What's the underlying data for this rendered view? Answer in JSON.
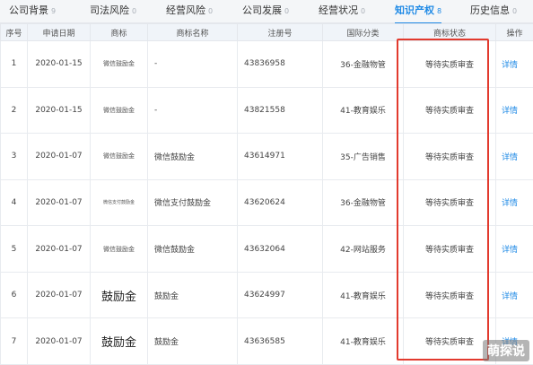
{
  "tabs": [
    {
      "label": "公司背景",
      "count": "9",
      "active": false
    },
    {
      "label": "司法风险",
      "count": "0",
      "active": false
    },
    {
      "label": "经营风险",
      "count": "0",
      "active": false
    },
    {
      "label": "公司发展",
      "count": "0",
      "active": false
    },
    {
      "label": "经营状况",
      "count": "0",
      "active": false
    },
    {
      "label": "知识产权",
      "count": "8",
      "active": true
    },
    {
      "label": "历史信息",
      "count": "0",
      "active": false
    }
  ],
  "columns": [
    "序号",
    "申请日期",
    "商标",
    "商标名称",
    "注册号",
    "国际分类",
    "商标状态",
    "操作"
  ],
  "rows": [
    {
      "index": "1",
      "date": "2020-01-15",
      "logo": "微信鼓励金",
      "name": "-",
      "reg": "43836958",
      "class": "36-金融物管",
      "status": "等待实质审查",
      "action": "详情"
    },
    {
      "index": "2",
      "date": "2020-01-15",
      "logo": "微信鼓励金",
      "name": "-",
      "reg": "43821558",
      "class": "41-教育娱乐",
      "status": "等待实质审查",
      "action": "详情"
    },
    {
      "index": "3",
      "date": "2020-01-07",
      "logo": "微信鼓励金",
      "name": "微信鼓励金",
      "reg": "43614971",
      "class": "35-广告销售",
      "status": "等待实质审查",
      "action": "详情"
    },
    {
      "index": "4",
      "date": "2020-01-07",
      "logo": "微信支付鼓励金",
      "name": "微信支付鼓励金",
      "reg": "43620624",
      "class": "36-金融物管",
      "status": "等待实质审查",
      "action": "详情"
    },
    {
      "index": "5",
      "date": "2020-01-07",
      "logo": "微信鼓励金",
      "name": "微信鼓励金",
      "reg": "43632064",
      "class": "42-网站服务",
      "status": "等待实质审查",
      "action": "详情"
    },
    {
      "index": "6",
      "date": "2020-01-07",
      "logo": "鼓励金",
      "name": "鼓励金",
      "reg": "43624997",
      "class": "41-教育娱乐",
      "status": "等待实质审查",
      "action": "详情"
    },
    {
      "index": "7",
      "date": "2020-01-07",
      "logo": "鼓励金",
      "name": "鼓励金",
      "reg": "43636585",
      "class": "41-教育娱乐",
      "status": "等待实质审查",
      "action": "详情"
    }
  ],
  "watermark": "萌探说",
  "colors": {
    "accent": "#1f8ae6",
    "highlight": "#e23a2e",
    "header_bg": "#f0f4f9"
  }
}
